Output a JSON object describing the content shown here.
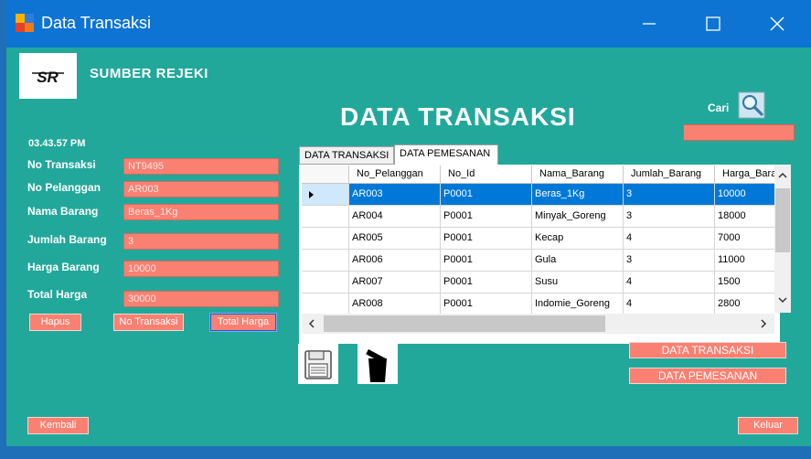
{
  "window": {
    "title": "Data Transaksi",
    "controls": [
      "minimize",
      "maximize",
      "close"
    ]
  },
  "header": {
    "logo_text": "SR",
    "company": "SUMBER REJEKI",
    "title": "DATA TRANSAKSI",
    "search_label": "Cari",
    "search_value": ""
  },
  "clock": "03.43.57 PM",
  "form": {
    "no_transaksi": {
      "label": "No Transaksi",
      "value": "NT9495"
    },
    "no_pelanggan": {
      "label": "No Pelanggan",
      "value": "AR003"
    },
    "nama_barang": {
      "label": "Nama Barang",
      "value": "Beras_1Kg"
    },
    "jumlah_barang": {
      "label": "Jumlah Barang",
      "value": "3"
    },
    "harga_barang": {
      "label": "Harga Barang",
      "value": "10000"
    },
    "total_harga": {
      "label": "Total Harga",
      "value": "30000"
    }
  },
  "buttons": {
    "hapus": "Hapus",
    "no_transaksi": "No Transaksi",
    "total_harga": "Total Harga",
    "kembali": "Kembali",
    "keluar": "Keluar",
    "data_transaksi": "DATA TRANSAKSI",
    "data_pemesanan": "DATA PEMESANAN"
  },
  "tabs": [
    "DATA TRANSAKSI",
    "DATA PEMESANAN"
  ],
  "grid": {
    "columns": [
      "No_Pelanggan",
      "No_Id",
      "Nama_Barang",
      "Jumlah_Barang",
      "Harga_Bara"
    ],
    "rows": [
      [
        "AR003",
        "P0001",
        "Beras_1Kg",
        "3",
        "10000"
      ],
      [
        "AR004",
        "P0001",
        "Minyak_Goreng",
        "3",
        "18000"
      ],
      [
        "AR005",
        "P0001",
        "Kecap",
        "4",
        "7000"
      ],
      [
        "AR006",
        "P0001",
        "Gula",
        "3",
        "11000"
      ],
      [
        "AR007",
        "P0001",
        "Susu",
        "4",
        "1500"
      ],
      [
        "AR008",
        "P0001",
        "Indomie_Goreng",
        "4",
        "2800"
      ]
    ],
    "selected_row": 0
  },
  "icons": {
    "save": "save-icon",
    "delete": "trash-icon",
    "search": "magnifier-icon"
  },
  "colors": {
    "background": "#22a89a",
    "input": "#fa8072",
    "titlebar": "#0d74d4",
    "selection": "#0078d7"
  }
}
